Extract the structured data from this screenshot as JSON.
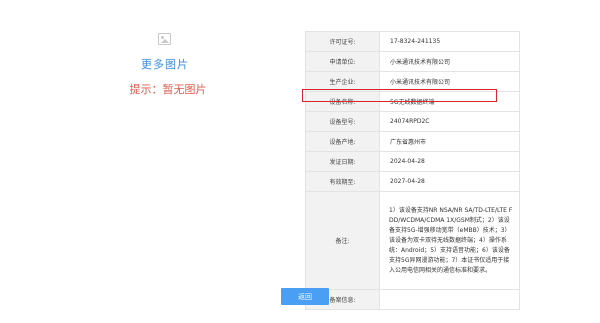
{
  "left_panel": {
    "image_icon": "image-placeholder-icon",
    "more_images": "更多图片",
    "hint": "提示：暂无图片"
  },
  "colors": {
    "link_blue": "#3a8ee6",
    "hint_red": "#e05a4f",
    "highlight_red": "#d8262a",
    "button_blue": "#4a9ff5"
  },
  "info_table": {
    "rows": [
      {
        "label": "许可证号:",
        "value": "17-8324-241135"
      },
      {
        "label": "申请单位:",
        "value": "小米通讯技术有限公司"
      },
      {
        "label": "生产企业:",
        "value": "小米通讯技术有限公司"
      },
      {
        "label": "设备名称:",
        "value": "5G无线数据终端"
      },
      {
        "label": "设备型号:",
        "value": "24074RPD2C"
      },
      {
        "label": "设备产地:",
        "value": "广东省惠州市"
      },
      {
        "label": "发证日期:",
        "value": "2024-04-28"
      },
      {
        "label": "有效期至:",
        "value": "2027-04-28"
      },
      {
        "label": "备注:",
        "value": "1）该设备支持NR NSA/NR SA/TD-LTE/LTE FDD/WCDMA/CDMA 1X/GSM制式；2）该设备支持5G-增强移动宽带（eMBB）技术；3）该设备为双卡双待无线数据终端；4）操作系统：Android；5）支持语音功能；6）该设备支持5G异网漫游功能；7）本证书仅适用于接入公用电信网相关的通信标准和要求。"
      },
      {
        "label": "备案信息:",
        "value": ""
      }
    ]
  },
  "back_button": "返回"
}
